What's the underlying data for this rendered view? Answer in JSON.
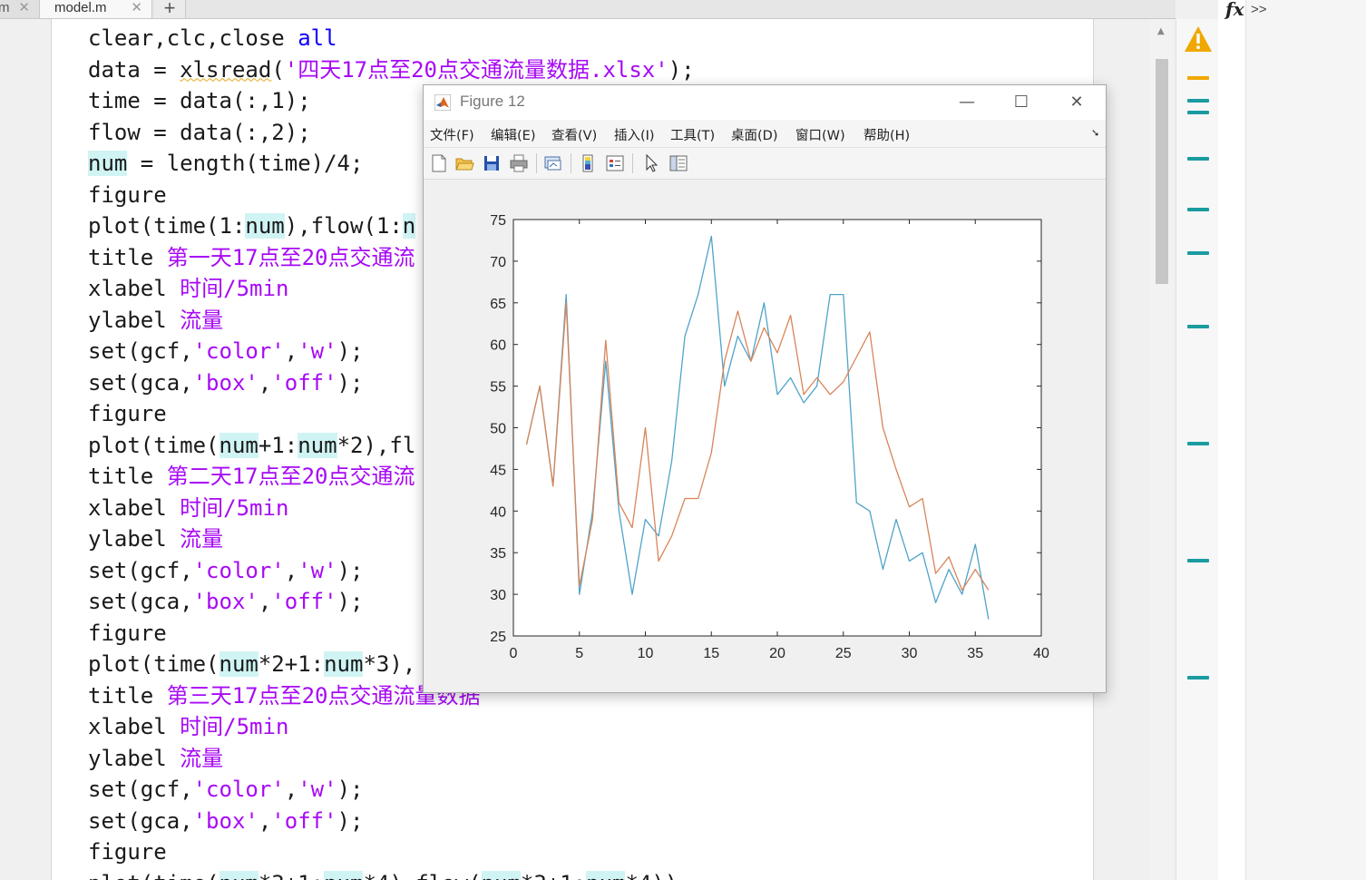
{
  "editor": {
    "tabs": [
      {
        "label": "m"
      },
      {
        "label": "model.m"
      }
    ],
    "add_tab_label": "+",
    "close_glyph": "✕",
    "lines": [
      [
        {
          "t": "clear,clc,close "
        },
        {
          "t": "all",
          "c": "kw"
        }
      ],
      [
        {
          "t": "data = "
        },
        {
          "t": "xlsread",
          "c": "sq"
        },
        {
          "t": "("
        },
        {
          "t": "'四天17点至20点交通流量数据.xlsx'",
          "c": "str"
        },
        {
          "t": ");"
        }
      ],
      [
        {
          "t": "time = data(:,1);"
        }
      ],
      [
        {
          "t": "flow = data(:,2);"
        }
      ],
      [
        {
          "t": "num",
          "c": "hl"
        },
        {
          "t": " = length(time)/4;"
        }
      ],
      [
        {
          "t": "figure"
        }
      ],
      [
        {
          "t": "plot(time(1:"
        },
        {
          "t": "num",
          "c": "hl"
        },
        {
          "t": "),flow(1:"
        },
        {
          "t": "n",
          "c": "hl"
        }
      ],
      [
        {
          "t": "title "
        },
        {
          "t": "第一天17点至20点交通流",
          "c": "cmd"
        }
      ],
      [
        {
          "t": "xlabel "
        },
        {
          "t": "时间/5min",
          "c": "cmd"
        }
      ],
      [
        {
          "t": "ylabel "
        },
        {
          "t": "流量",
          "c": "cmd"
        }
      ],
      [
        {
          "t": "set(gcf,"
        },
        {
          "t": "'color'",
          "c": "str"
        },
        {
          "t": ","
        },
        {
          "t": "'w'",
          "c": "str"
        },
        {
          "t": ");"
        }
      ],
      [
        {
          "t": "set(gca,"
        },
        {
          "t": "'box'",
          "c": "str"
        },
        {
          "t": ","
        },
        {
          "t": "'off'",
          "c": "str"
        },
        {
          "t": ");"
        }
      ],
      [
        {
          "t": "figure"
        }
      ],
      [
        {
          "t": "plot(time("
        },
        {
          "t": "num",
          "c": "hl"
        },
        {
          "t": "+1:"
        },
        {
          "t": "num",
          "c": "hl"
        },
        {
          "t": "*2),fl"
        }
      ],
      [
        {
          "t": "title "
        },
        {
          "t": "第二天17点至20点交通流",
          "c": "cmd"
        }
      ],
      [
        {
          "t": "xlabel "
        },
        {
          "t": "时间/5min",
          "c": "cmd"
        }
      ],
      [
        {
          "t": "ylabel "
        },
        {
          "t": "流量",
          "c": "cmd"
        }
      ],
      [
        {
          "t": "set(gcf,"
        },
        {
          "t": "'color'",
          "c": "str"
        },
        {
          "t": ","
        },
        {
          "t": "'w'",
          "c": "str"
        },
        {
          "t": ");"
        }
      ],
      [
        {
          "t": "set(gca,"
        },
        {
          "t": "'box'",
          "c": "str"
        },
        {
          "t": ","
        },
        {
          "t": "'off'",
          "c": "str"
        },
        {
          "t": ");"
        }
      ],
      [
        {
          "t": "figure"
        }
      ],
      [
        {
          "t": "plot(time("
        },
        {
          "t": "num",
          "c": "hl"
        },
        {
          "t": "*2+1:"
        },
        {
          "t": "num",
          "c": "hl"
        },
        {
          "t": "*3),"
        }
      ],
      [
        {
          "t": "title "
        },
        {
          "t": "第三天17点至20点交通流量数据",
          "c": "cmd"
        }
      ],
      [
        {
          "t": "xlabel "
        },
        {
          "t": "时间/5min",
          "c": "cmd"
        }
      ],
      [
        {
          "t": "ylabel "
        },
        {
          "t": "流量",
          "c": "cmd"
        }
      ],
      [
        {
          "t": "set(gcf,"
        },
        {
          "t": "'color'",
          "c": "str"
        },
        {
          "t": ","
        },
        {
          "t": "'w'",
          "c": "str"
        },
        {
          "t": ");"
        }
      ],
      [
        {
          "t": "set(gca,"
        },
        {
          "t": "'box'",
          "c": "str"
        },
        {
          "t": ","
        },
        {
          "t": "'off'",
          "c": "str"
        },
        {
          "t": ");"
        }
      ],
      [
        {
          "t": "figure"
        }
      ],
      [
        {
          "t": "plot(time("
        },
        {
          "t": "num",
          "c": "hl"
        },
        {
          "t": "*3+1:"
        },
        {
          "t": "num",
          "c": "hl"
        },
        {
          "t": "*4),flow("
        },
        {
          "t": "num",
          "c": "hl"
        },
        {
          "t": "*3+1:"
        },
        {
          "t": "num",
          "c": "hl"
        },
        {
          "t": "*4))"
        }
      ]
    ]
  },
  "analyzer": {
    "warning_icon": "warning-triangle-icon",
    "colors": {
      "marker": "#1a9ba0",
      "warning": "#f0a800"
    }
  },
  "command_strip": {
    "fx_label": "fx",
    "more_label": ">>"
  },
  "figure_window": {
    "title": "Figure 12",
    "app_icon": "matlab-icon",
    "window_controls": {
      "minimize": "—",
      "maximize": "☐",
      "close": "✕"
    },
    "menus": [
      "文件(F)",
      "编辑(E)",
      "查看(V)",
      "插入(I)",
      "工具(T)",
      "桌面(D)",
      "窗口(W)",
      "帮助(H)"
    ],
    "toolbar_icons": [
      "new-figure-icon",
      "open-file-icon",
      "save-icon",
      "print-icon",
      "link-plot-icon",
      "colorbar-icon",
      "legend-icon",
      "pointer-icon",
      "property-inspector-icon"
    ]
  },
  "chart_data": {
    "type": "line",
    "title": "",
    "xlabel": "",
    "ylabel": "",
    "xlim": [
      0,
      40
    ],
    "ylim": [
      25,
      75
    ],
    "xticks": [
      0,
      5,
      10,
      15,
      20,
      25,
      30,
      35,
      40
    ],
    "yticks": [
      25,
      30,
      35,
      40,
      45,
      50,
      55,
      60,
      65,
      70,
      75
    ],
    "grid": false,
    "box": true,
    "series": [
      {
        "color": "#4fa3c9",
        "x": [
          1,
          2,
          3,
          4,
          5,
          6,
          7,
          8,
          9,
          10,
          11,
          12,
          13,
          14,
          15,
          16,
          17,
          18,
          19,
          20,
          21,
          22,
          23,
          24,
          25,
          26,
          27,
          28,
          29,
          30,
          31,
          32,
          33,
          34,
          35,
          36
        ],
        "y": [
          48,
          55,
          43,
          66,
          30,
          40,
          58,
          40,
          30,
          39,
          37,
          46,
          61,
          66,
          73,
          55,
          61,
          58,
          65,
          54,
          56,
          53,
          55,
          66,
          66,
          41,
          40,
          33,
          39,
          34,
          35,
          29,
          33,
          30,
          36,
          27
        ]
      },
      {
        "color": "#d8855a",
        "x": [
          1,
          2,
          3,
          4,
          5,
          6,
          7,
          8,
          9,
          10,
          11,
          12,
          13,
          14,
          15,
          16,
          17,
          18,
          19,
          20,
          21,
          22,
          23,
          24,
          25,
          26,
          27,
          28,
          29,
          30,
          31,
          32,
          33,
          34,
          35,
          36
        ],
        "y": [
          48,
          55,
          43,
          65,
          31,
          39,
          60.5,
          41,
          38,
          50,
          34,
          37,
          41.5,
          41.5,
          47,
          58,
          64,
          58,
          62,
          59,
          63.5,
          54,
          56,
          54,
          55.5,
          58.5,
          61.5,
          50,
          45,
          40.5,
          41.5,
          32.5,
          34.5,
          30.5,
          33,
          30.5
        ]
      }
    ]
  }
}
